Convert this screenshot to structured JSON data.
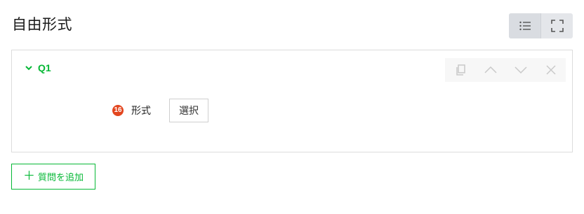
{
  "page": {
    "title": "自由形式"
  },
  "view_toggle": {
    "icons": [
      "list-icon",
      "fullscreen-icon"
    ]
  },
  "question": {
    "label": "Q1",
    "expanded": true,
    "actions": [
      "copy-icon",
      "chevron-up-icon",
      "chevron-down-icon",
      "close-icon"
    ],
    "field": {
      "number": "16",
      "label": "形式",
      "select_label": "選択"
    }
  },
  "add_question": {
    "plus": "＋",
    "label": "質問を追加"
  },
  "colors": {
    "accent": "#06b836",
    "badge": "#e3461f",
    "border": "#dcdcdc"
  }
}
